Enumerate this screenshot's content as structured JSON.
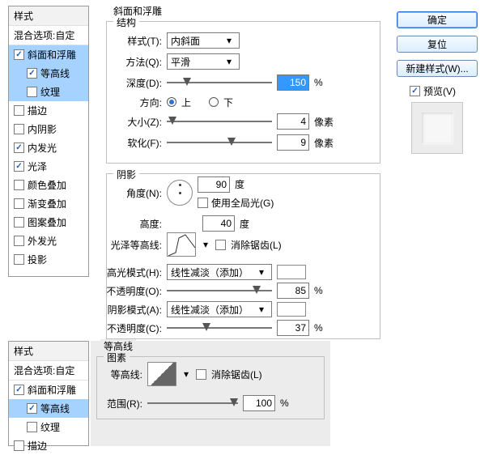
{
  "styles_panel": {
    "title": "样式",
    "blend_label": "混合选项:自定",
    "items": [
      {
        "label": "斜面和浮雕",
        "checked": true,
        "selected": true
      },
      {
        "label": "等高线",
        "checked": true,
        "child": true,
        "selected": true
      },
      {
        "label": "纹理",
        "checked": false,
        "child": true,
        "selected": true
      },
      {
        "label": "描边",
        "checked": false
      },
      {
        "label": "内阴影",
        "checked": false
      },
      {
        "label": "内发光",
        "checked": true
      },
      {
        "label": "光泽",
        "checked": true
      },
      {
        "label": "颜色叠加",
        "checked": false
      },
      {
        "label": "渐变叠加",
        "checked": false
      },
      {
        "label": "图案叠加",
        "checked": false
      },
      {
        "label": "外发光",
        "checked": false
      },
      {
        "label": "投影",
        "checked": false
      }
    ]
  },
  "styles_panel2": {
    "title": "样式",
    "blend_label": "混合选项:自定",
    "items": [
      {
        "label": "斜面和浮雕",
        "checked": true
      },
      {
        "label": "等高线",
        "checked": true,
        "child": true,
        "selected": true
      },
      {
        "label": "纹理",
        "checked": false,
        "child": true
      },
      {
        "label": "描边",
        "checked": false
      }
    ]
  },
  "section": {
    "bevel_title": "斜面和浮雕",
    "structure": "结构",
    "style_label": "样式(T):",
    "style_value": "内斜面",
    "method_label": "方法(Q):",
    "method_value": "平滑",
    "depth_label": "深度(D):",
    "depth_value": "150",
    "percent": "%",
    "direction_label": "方向:",
    "dir_up": "上",
    "dir_down": "下",
    "size_label": "大小(Z):",
    "size_value": "4",
    "pixels": "像素",
    "soften_label": "软化(F):",
    "soften_value": "9",
    "shadow": "阴影",
    "angle_label": "角度(N):",
    "angle_value": "90",
    "degree": "度",
    "global_light": "使用全局光(G)",
    "altitude_label": "高度:",
    "altitude_value": "40",
    "gloss_contour_label": "光泽等高线:",
    "antialias": "消除锯齿(L)",
    "hl_mode_label": "高光模式(H):",
    "hl_mode_value": "线性减淡（添加）",
    "hl_opacity_label": "不透明度(O):",
    "hl_opacity_value": "85",
    "sh_mode_label": "阴影模式(A):",
    "sh_mode_value": "线性减淡（添加）",
    "sh_opacity_label": "不透明度(C):",
    "sh_opacity_value": "37",
    "contour_title": "等高线",
    "elements": "图素",
    "contour_label": "等高线:",
    "antialias2": "消除锯齿(L)",
    "range_label": "范围(R):",
    "range_value": "100"
  },
  "right": {
    "ok": "确定",
    "reset": "复位",
    "new_style": "新建样式(W)...",
    "preview": "预览(V)"
  }
}
